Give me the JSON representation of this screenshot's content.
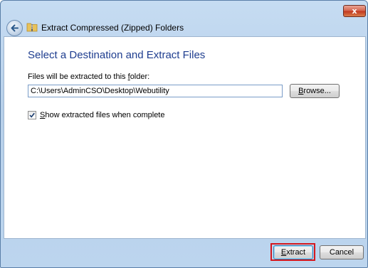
{
  "window": {
    "title": "Extract Compressed (Zipped) Folders",
    "close_label": "x"
  },
  "dialog": {
    "heading": "Select a Destination and Extract Files",
    "label_prefix": "Files will be extracted to this ",
    "label_key": "f",
    "label_suffix": "older:",
    "path_value": "C:\\Users\\AdminCSO\\Desktop\\Webutility",
    "browse_key": "B",
    "browse_rest": "rowse...",
    "checkbox_checked": true,
    "checkbox_key": "S",
    "checkbox_rest": "how extracted files when complete"
  },
  "footer": {
    "extract_key": "E",
    "extract_rest": "xtract",
    "cancel_label": "Cancel"
  },
  "colors": {
    "highlight": "#d4171e",
    "heading": "#1e3d8f"
  }
}
